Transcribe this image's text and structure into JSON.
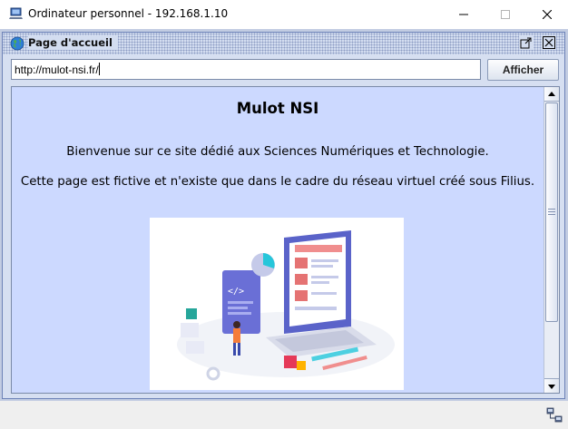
{
  "window": {
    "title": "Ordinateur personnel - 192.168.1.10",
    "icons": {
      "app": "computer-icon",
      "minimize": "minimize-icon",
      "maximize": "maximize-icon",
      "close": "close-icon"
    }
  },
  "browser": {
    "frame_title": "Page d'accueil",
    "title_icon": "globe-icon",
    "url": "http://mulot-nsi.fr/",
    "go_button_label": "Afficher",
    "frame_buttons": [
      "detach-icon",
      "close-icon"
    ]
  },
  "page": {
    "heading": "Mulot NSI",
    "welcome": "Bienvenue sur ce site dédié aux Sciences Numériques et Technologie.",
    "notice": "Cette page est fictive et n'existe que dans le cadre du réseau virtuel créé sous Filius.",
    "illustration": "developer-laptop-illustration"
  },
  "colors": {
    "page_background": "#ccd9ff",
    "frame_background": "#c2cce2",
    "frame_border": "#6d82b7",
    "title_pattern": "#8d9dc4"
  },
  "statusbar": {
    "icon": "network-icon"
  }
}
